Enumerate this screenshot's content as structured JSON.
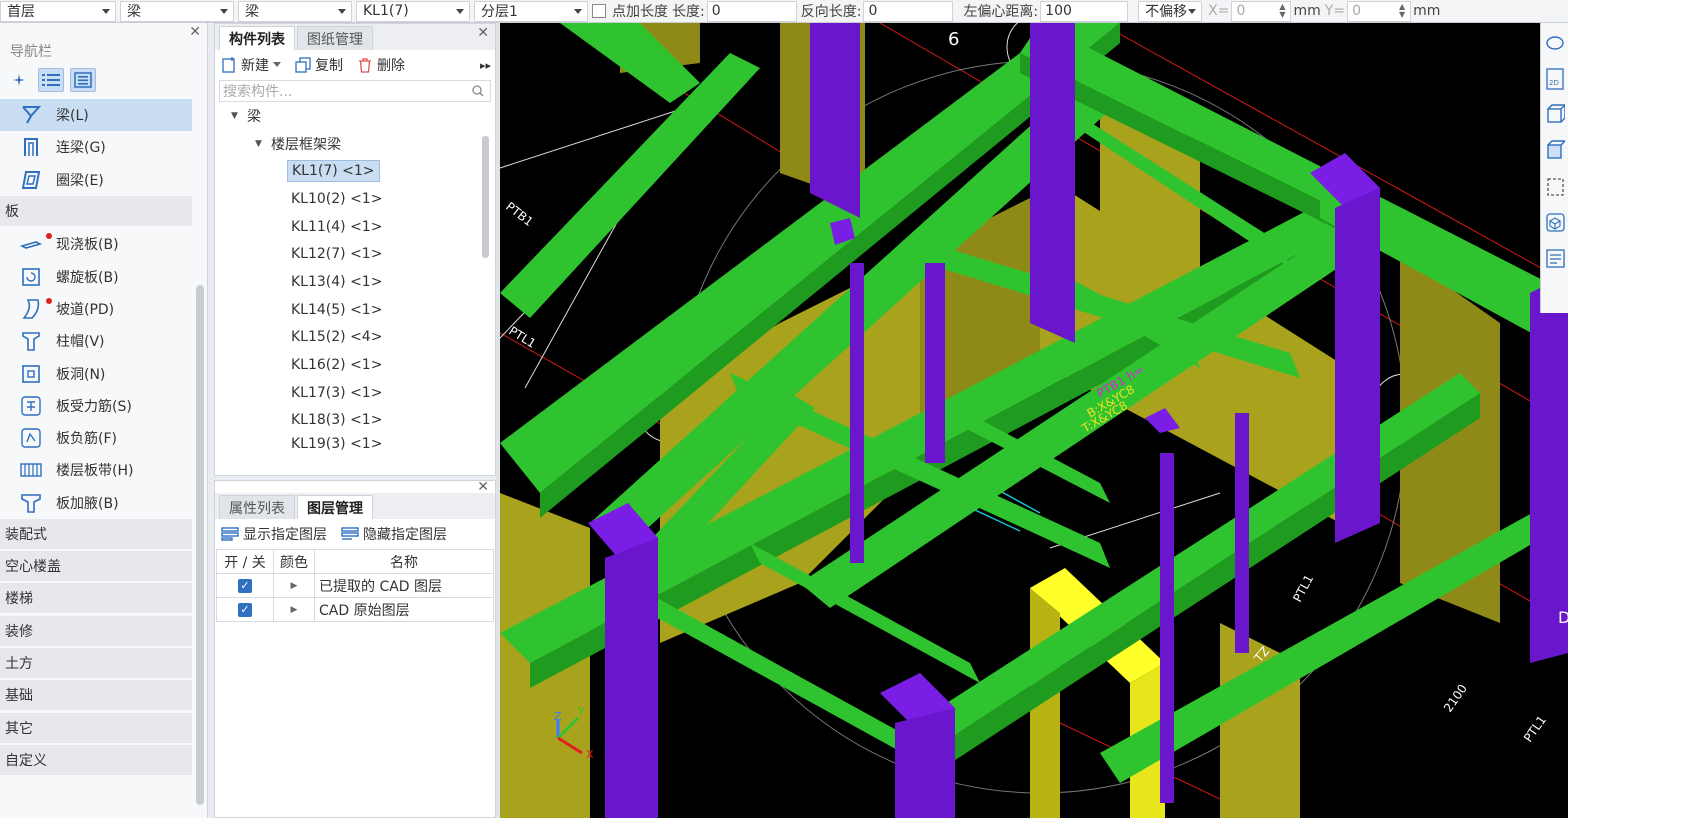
{
  "topbar": {
    "floor": "首层",
    "category": "梁",
    "type": "梁",
    "component": "KL1(7)",
    "sublayer": "分层1",
    "point_length_label": "点加长度",
    "length_label": "长度:",
    "length_value": "0",
    "reverse_length_label": "反向长度:",
    "reverse_length_value": "0",
    "left_offset_label": "左偏心距离:",
    "left_offset_value": "100",
    "offset_mode": "不偏移",
    "x_label": "X=",
    "x_value": "0",
    "x_unit": "mm",
    "y_label": "Y=",
    "y_value": "0",
    "y_unit": "mm"
  },
  "nav": {
    "title": "导航栏",
    "items_top": [
      {
        "label": "梁(L)",
        "icon": "beam-icon",
        "active": true
      },
      {
        "label": "连梁(G)",
        "icon": "coupling-beam-icon"
      },
      {
        "label": "圈梁(E)",
        "icon": "ring-beam-icon"
      }
    ],
    "cat_slab": "板",
    "items_slab": [
      {
        "label": "现浇板(B)",
        "icon": "cast-slab-icon",
        "dot": true
      },
      {
        "label": "螺旋板(B)",
        "icon": "spiral-slab-icon"
      },
      {
        "label": "坡道(PD)",
        "icon": "ramp-icon",
        "dot": true
      },
      {
        "label": "柱帽(V)",
        "icon": "column-cap-icon"
      },
      {
        "label": "板洞(N)",
        "icon": "slab-hole-icon"
      },
      {
        "label": "板受力筋(S)",
        "icon": "slab-main-rebar-icon"
      },
      {
        "label": "板负筋(F)",
        "icon": "slab-negative-rebar-icon"
      },
      {
        "label": "楼层板带(H)",
        "icon": "floor-strip-icon"
      },
      {
        "label": "板加腋(B)",
        "icon": "slab-haunch-icon"
      }
    ],
    "categories": [
      "装配式",
      "空心楼盖",
      "楼梯",
      "装修",
      "土方",
      "基础",
      "其它",
      "自定义"
    ]
  },
  "components": {
    "tab_list": "构件列表",
    "tab_drawings": "图纸管理",
    "btn_new": "新建",
    "btn_copy": "复制",
    "btn_delete": "删除",
    "search_placeholder": "搜索构件...",
    "root": "梁",
    "group": "楼层框架梁",
    "leaves": [
      "KL1(7) <1>",
      "KL10(2) <1>",
      "KL11(4) <1>",
      "KL12(7) <1>",
      "KL13(4) <1>",
      "KL14(5) <1>",
      "KL15(2) <4>",
      "KL16(2) <1>",
      "KL17(3) <1>",
      "KL18(3) <1>",
      "KL19(3) <1>"
    ]
  },
  "layers": {
    "tab_props": "属性列表",
    "tab_layers": "图层管理",
    "btn_show": "显示指定图层",
    "btn_hide": "隐藏指定图层",
    "col_toggle": "开 / 关",
    "col_color": "颜色",
    "col_name": "名称",
    "rows": [
      {
        "name": "已提取的 CAD 图层",
        "on": true
      },
      {
        "name": "CAD 原始图层",
        "on": true
      }
    ]
  },
  "canvas": {
    "axis_number": "6",
    "text_labels": [
      "PTB1",
      "PTL1",
      "PTB1 h=",
      "B:X&YC8",
      "T:X&YC8",
      "PTL1",
      "TZ",
      "2100",
      "PTL1",
      "D"
    ],
    "axis_z": "Z",
    "axis_y": "Y",
    "axis_x": "X",
    "colors": {
      "beam": "#2fc42f",
      "column": "#7a1ee6",
      "wall": "#a8a21d",
      "highlight": "#ffff2a",
      "bg": "#000000"
    }
  }
}
